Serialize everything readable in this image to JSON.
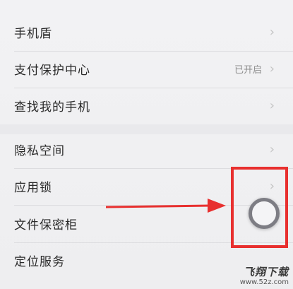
{
  "settings": {
    "items": [
      {
        "label": "手机盾",
        "status": "",
        "chevron": "›"
      },
      {
        "label": "支付保护中心",
        "status": "已开启",
        "chevron": "›"
      },
      {
        "label": "查找我的手机",
        "status": "",
        "chevron": "›"
      },
      {
        "label": "隐私空间",
        "status": "",
        "chevron": "›"
      },
      {
        "label": "应用锁",
        "status": "",
        "chevron": "›"
      },
      {
        "label": "文件保密柜",
        "status": "",
        "chevron": ""
      },
      {
        "label": "定位服务",
        "status": "",
        "chevron": ""
      }
    ]
  },
  "watermark": {
    "title": "飞翔下载",
    "url": "www.52z.com"
  },
  "colors": {
    "highlight": "#e8302f",
    "text": "#2a2a2a",
    "status": "#8d8d8d"
  }
}
